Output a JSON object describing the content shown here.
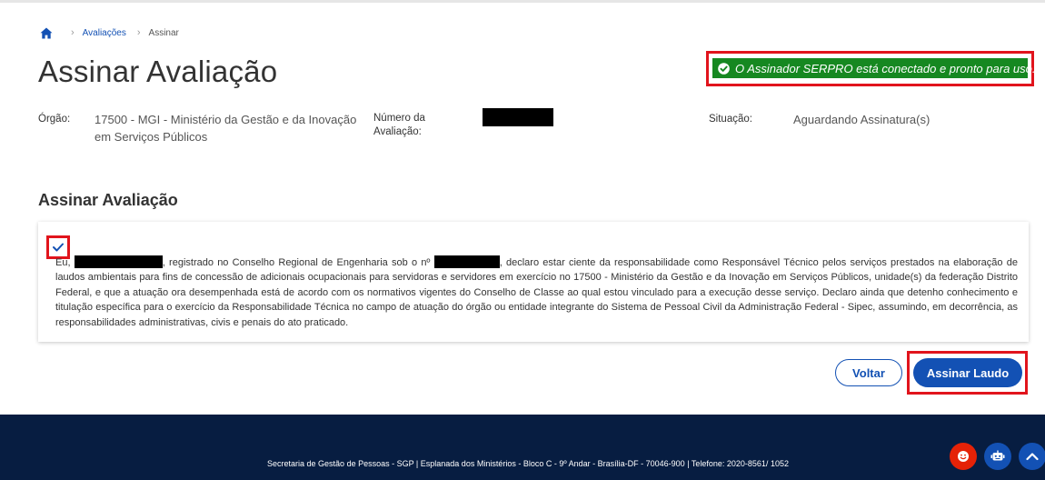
{
  "breadcrumb": {
    "home_icon": "home-icon",
    "items": [
      {
        "label": "Avaliações"
      },
      {
        "label": "Assinar"
      }
    ]
  },
  "page": {
    "title": "Assinar Avaliação"
  },
  "status": {
    "message": "O Assinador SERPRO está conectado e pronto para uso.",
    "icon": "check-circle-icon",
    "color": "#168821"
  },
  "info": {
    "orgao_label": "Órgão:",
    "orgao_value_line1": "17500 - MGI - Ministério da Gestão e da Inovação",
    "orgao_value_line2": "em Serviços Públicos",
    "numero_label_line1": "Número da",
    "numero_label_line2": "Avaliação:",
    "situacao_label": "Situação:",
    "situacao_value": "Aguardando Assinatura(s)"
  },
  "section": {
    "title": "Assinar Avaliação"
  },
  "declaration": {
    "checked": true,
    "prefix": "Eu,",
    "part2": ", registrado no Conselho Regional de Engenharia sob o nº",
    "part3": ", declaro estar ciente da responsabilidade como Responsável Técnico pelos serviços prestados na elaboração de laudos ambientais para fins de concessão de adicionais ocupacionais para servidoras e servidores em exercício no 17500 - Ministério da Gestão e da Inovação em Serviços Públicos, unidade(s) da federação Distrito Federal, e que a atuação ora desempenhada está de acordo com os normativos vigentes do Conselho de Classe ao qual estou vinculado para a execução desse serviço. Declaro ainda que detenho conhecimento e titulação específica para o exercício da Responsabilidade Técnica no campo de atuação do órgão ou entidade integrante do Sistema de Pessoal Civil da Administração Federal - Sipec, assumindo, em decorrência, as responsabilidades administrativas, civis e penais do ato praticado."
  },
  "actions": {
    "back_label": "Voltar",
    "sign_label": "Assinar Laudo"
  },
  "footer": {
    "text": "Secretaria de Gestão de Pessoas - SGP | Esplanada dos Ministérios - Bloco C - 9º Andar - Brasília-DF - 70046-900 | Telefone: 2020-8561/ 1052",
    "buttons": [
      "feedback-icon",
      "chatbot-icon",
      "arrow-up-icon"
    ]
  },
  "colors": {
    "primary": "#1351b4",
    "success": "#168821",
    "highlight": "#e1141c",
    "footer_bg": "#071d41"
  }
}
